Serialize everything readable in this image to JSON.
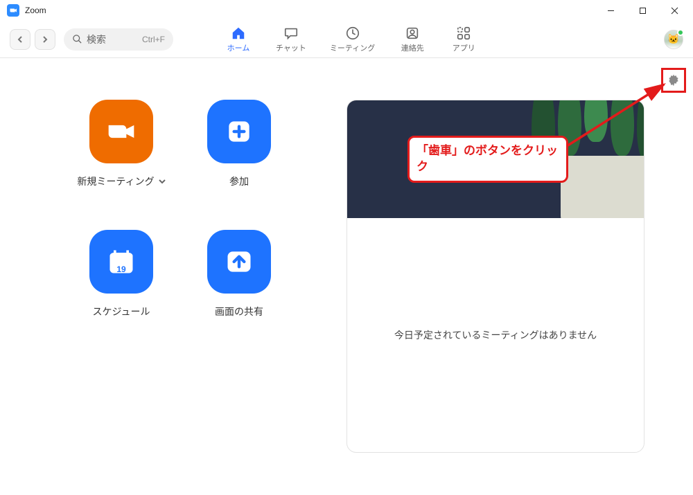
{
  "window": {
    "title": "Zoom"
  },
  "toolbar": {
    "search_placeholder": "検索",
    "search_shortcut": "Ctrl+F"
  },
  "tabs": {
    "home": "ホーム",
    "chat": "チャット",
    "meetings": "ミーティング",
    "contacts": "連絡先",
    "apps": "アプリ"
  },
  "actions": {
    "new_meeting": "新規ミーティング",
    "join": "参加",
    "schedule": "スケジュール",
    "share_screen": "画面の共有",
    "calendar_day": "19"
  },
  "right_panel": {
    "no_meeting": "今日予定されているミーティングはありません"
  },
  "callout": {
    "text": "「歯車」のボタンをクリック"
  }
}
